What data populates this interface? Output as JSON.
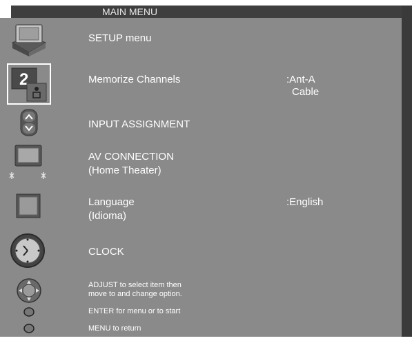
{
  "window": {
    "title": "MAIN MENU"
  },
  "items": [
    {
      "label": "SETUP menu"
    },
    {
      "label": "Memorize Channels",
      "value_line1": ":Ant-A",
      "value_line2": "Cable"
    },
    {
      "label": "INPUT ASSIGNMENT"
    },
    {
      "label": "AV CONNECTION",
      "sublabel": "(Home Theater)"
    },
    {
      "label": "Language",
      "sublabel": "(Idioma)",
      "value": ":English"
    },
    {
      "label": "CLOCK"
    }
  ],
  "help": {
    "adjust_line1": "ADJUST to select item then",
    "adjust_line2": "move to and change option.",
    "enter": "ENTER for menu or to start",
    "menu": "MENU to return"
  },
  "icons": [
    "tv-setup-icon",
    "channel-2-icon",
    "up-down-arrows-icon",
    "av-connection-icon",
    "language-icon",
    "clock-icon",
    "adjust-joystick-icon",
    "enter-button-icon",
    "menu-button-icon"
  ],
  "colors": {
    "panel": "#8a8a8a",
    "title_bar": "#3f3f3f",
    "text": "#ffffff",
    "selected_border": "#ffffff"
  }
}
